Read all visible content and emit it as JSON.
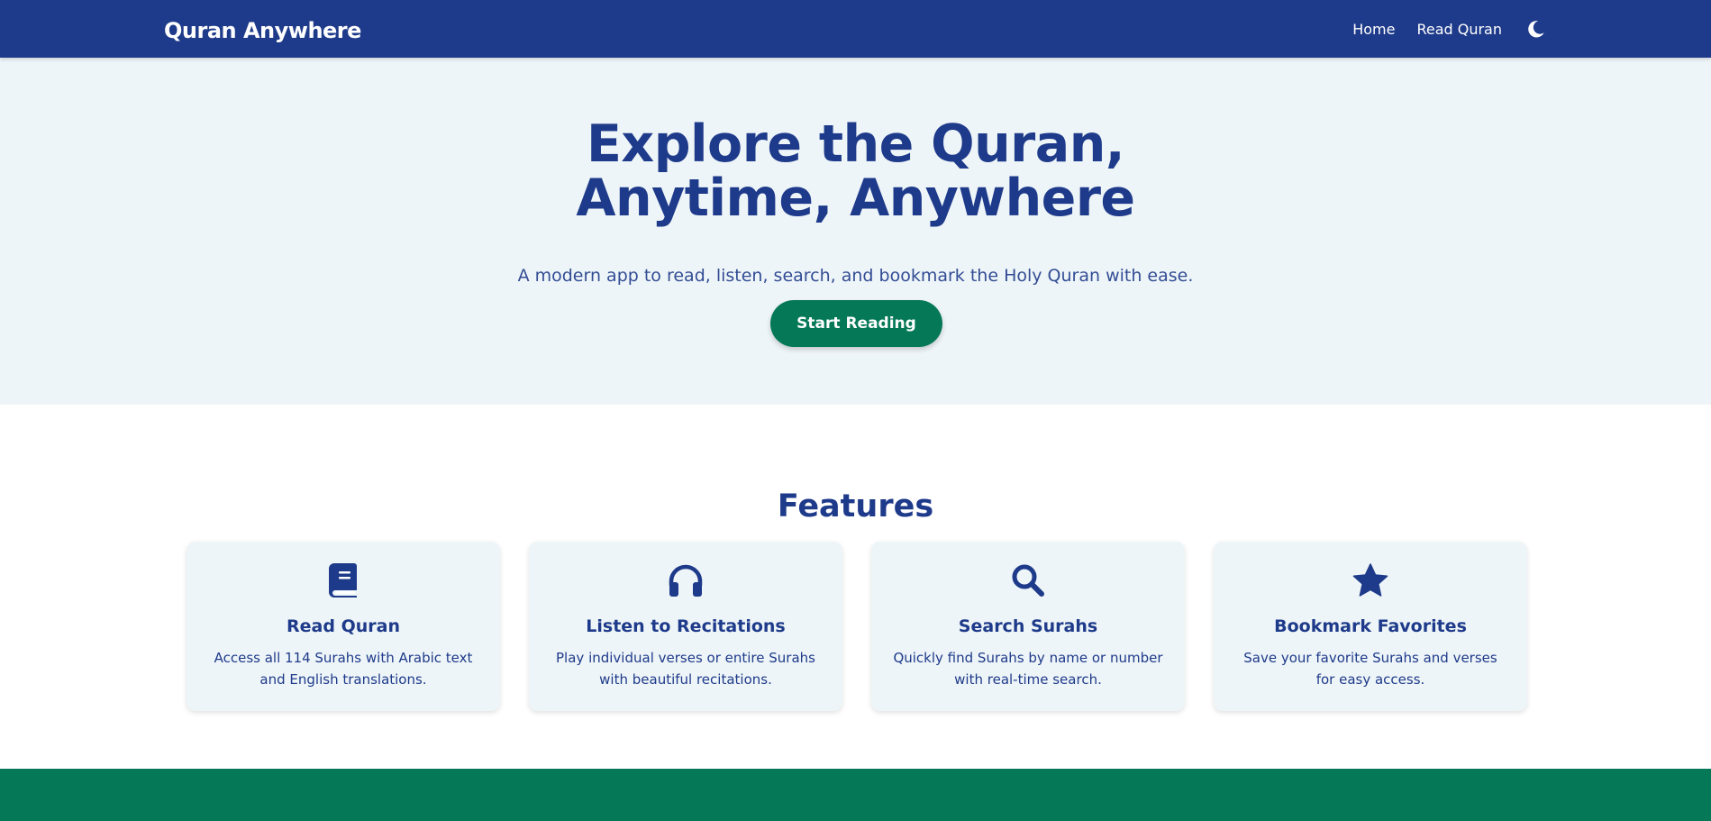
{
  "navbar": {
    "brand": "Quran Anywhere",
    "links": [
      "Home",
      "Read Quran"
    ],
    "theme_icon": "moon-icon"
  },
  "hero": {
    "title": "Explore the Quran, Anytime, Anywhere",
    "subtitle": "A modern app to read, listen, search, and bookmark the Holy Quran with ease.",
    "cta_label": "Start Reading"
  },
  "features": {
    "title": "Features",
    "items": [
      {
        "icon": "book-icon",
        "title": "Read Quran",
        "description": "Access all 114 Surahs with Arabic text and English translations."
      },
      {
        "icon": "headphones-icon",
        "title": "Listen to Recitations",
        "description": "Play individual verses or entire Surahs with beautiful recitations."
      },
      {
        "icon": "search-icon",
        "title": "Search Surahs",
        "description": "Quickly find Surahs by name or number with real-time search."
      },
      {
        "icon": "star-icon",
        "title": "Bookmark Favorites",
        "description": "Save your favorite Surahs and verses for easy access."
      }
    ]
  },
  "colors": {
    "primary": "#1e3a8a",
    "accent": "#047857",
    "hero_background": "#eef5f8"
  }
}
